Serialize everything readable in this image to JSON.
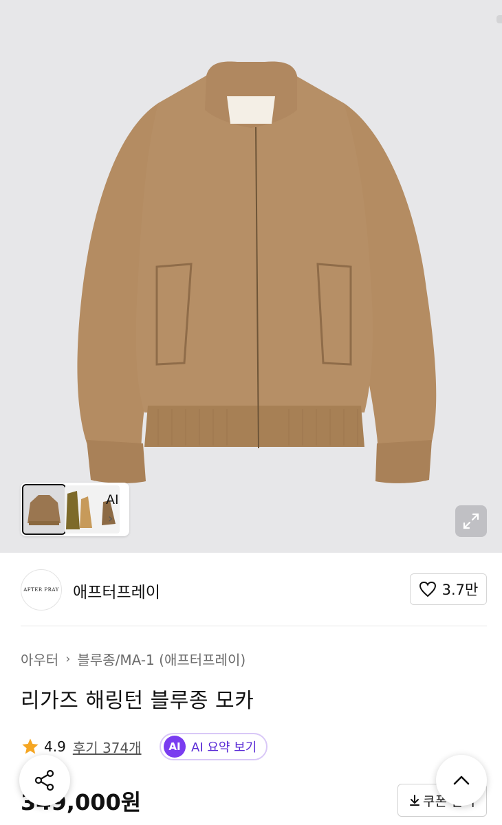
{
  "gallery": {
    "ai_label": "AI",
    "chevron": "›",
    "expand_icon": "expand-icon"
  },
  "brand": {
    "logo_text": "AFTER PRAY",
    "name": "애프터프레이",
    "like_count": "3.7만"
  },
  "breadcrumb": {
    "items": [
      "아우터",
      "블루종/MA-1 (애프터프레이)"
    ],
    "separator": "›"
  },
  "product": {
    "title": "리가즈 해링턴 블루종 모카",
    "rating": "4.9",
    "reviews": "후기 374개",
    "ai_badge": "AI",
    "ai_summary": "AI 요약 보기",
    "price": "349,000원",
    "coupon_label": "쿠폰 받기"
  },
  "colors": {
    "jacket": "#b68f66",
    "background": "#e7e7e9",
    "ai_accent": "#7a3cf0",
    "star": "#f5a623"
  }
}
